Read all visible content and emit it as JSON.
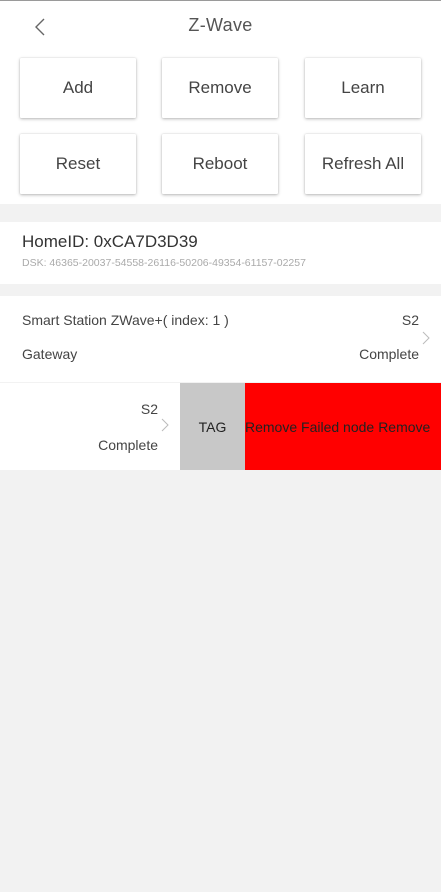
{
  "header": {
    "title": "Z-Wave"
  },
  "actions": {
    "add": "Add",
    "remove": "Remove",
    "learn": "Learn",
    "reset": "Reset",
    "reboot": "Reboot",
    "refresh_all": "Refresh All"
  },
  "network": {
    "home_id": "HomeID: 0xCA7D3D39",
    "dsk": "DSK: 46365-20037-54558-26116-50206-49354-61157-02257"
  },
  "devices": [
    {
      "name": "Smart Station ZWave+( index: 1 )",
      "type": "Gateway",
      "security": "S2",
      "status": "Complete"
    },
    {
      "security": "S2",
      "status": "Complete",
      "swipe_actions": {
        "tag": "TAG",
        "remove_failed": "Remove Failed node",
        "remove": "Remove"
      }
    }
  ],
  "colors": {
    "page_background": "#f2f2f2",
    "card_background": "#ffffff",
    "tag_action": "#c8c8c8",
    "danger_action": "#ff0000"
  }
}
